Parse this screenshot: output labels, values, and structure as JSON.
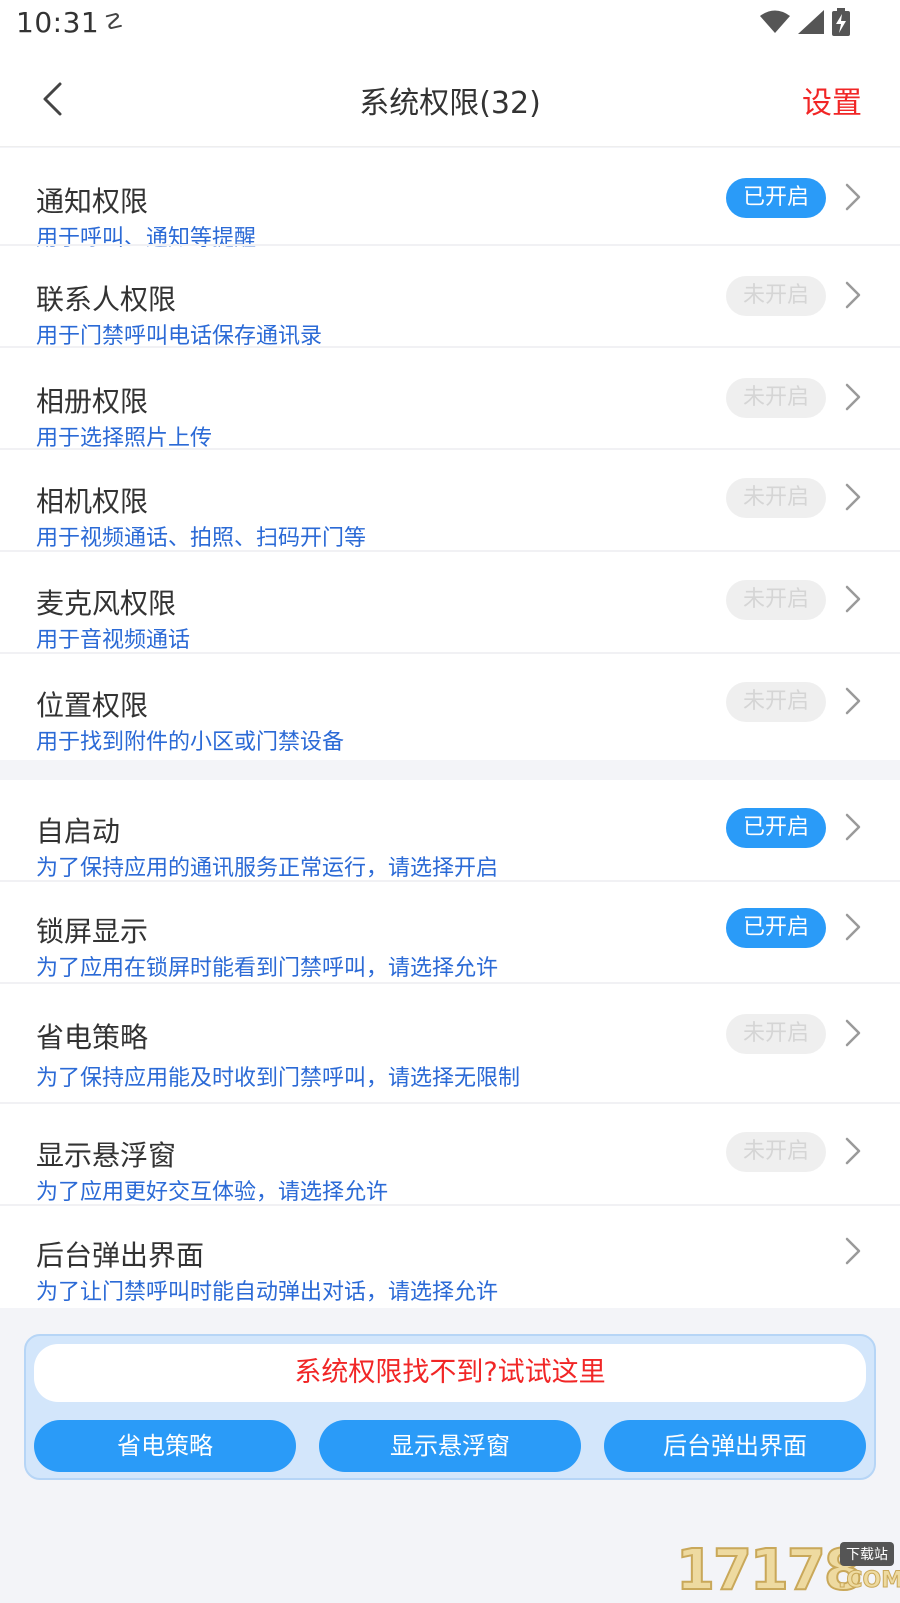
{
  "status_bar": {
    "time": "10:31",
    "usb_icon": "usb-icon",
    "wifi_icon": "wifi-icon",
    "signal_icon": "signal-icon",
    "battery_icon": "battery-charging-icon"
  },
  "header": {
    "back_icon": "chevron-left-icon",
    "title": "系统权限(32)",
    "settings_label": "设置"
  },
  "colors": {
    "accent_blue": "#2a9bf8",
    "desc_blue": "#2b6ad6",
    "alert_red": "#f12626",
    "badge_off_bg": "#efefef",
    "page_bg": "#f3f4f8"
  },
  "permission_groups": [
    {
      "items": [
        {
          "title": "通知权限",
          "desc": "用于呼叫、通知等提醒",
          "status": "已开启",
          "enabled": true
        },
        {
          "title": "联系人权限",
          "desc": "用于门禁呼叫电话保存通讯录",
          "status": "未开启",
          "enabled": false
        },
        {
          "title": "相册权限",
          "desc": "用于选择照片上传",
          "status": "未开启",
          "enabled": false
        },
        {
          "title": "相机权限",
          "desc": "用于视频通话、拍照、扫码开门等",
          "status": "未开启",
          "enabled": false
        },
        {
          "title": "麦克风权限",
          "desc": "用于音视频通话",
          "status": "未开启",
          "enabled": false
        },
        {
          "title": "位置权限",
          "desc": "用于找到附件的小区或门禁设备",
          "status": "未开启",
          "enabled": false
        }
      ]
    },
    {
      "items": [
        {
          "title": "自启动",
          "desc": "为了保持应用的通讯服务正常运行，请选择开启",
          "status": "已开启",
          "enabled": true
        },
        {
          "title": "锁屏显示",
          "desc": "为了应用在锁屏时能看到门禁呼叫，请选择允许",
          "status": "已开启",
          "enabled": true
        },
        {
          "title": "省电策略",
          "desc": "为了保持应用能及时收到门禁呼叫，请选择无限制",
          "status": "未开启",
          "enabled": false
        },
        {
          "title": "显示悬浮窗",
          "desc": "为了应用更好交互体验，请选择允许",
          "status": "未开启",
          "enabled": false
        },
        {
          "title": "后台弹出界面",
          "desc": "为了让门禁呼叫时能自动弹出对话，请选择允许",
          "status": "",
          "enabled": null
        }
      ]
    }
  ],
  "help_card": {
    "banner": "系统权限找不到?试试这里",
    "buttons": [
      "省电策略",
      "显示悬浮窗",
      "后台弹出界面"
    ]
  },
  "watermark": {
    "digits": "17178",
    "tag": "下载站",
    "suffix": ".COM"
  }
}
